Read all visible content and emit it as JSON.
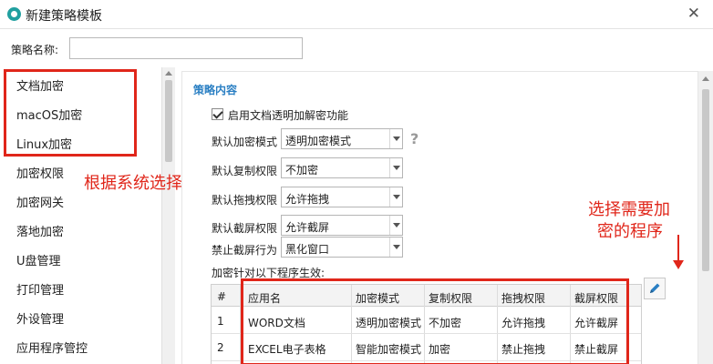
{
  "window": {
    "title": "新建策略模板",
    "close_glyph": "✕"
  },
  "name_row": {
    "label": "策略名称:",
    "value": ""
  },
  "sidebar": {
    "items": [
      {
        "label": "文档加密"
      },
      {
        "label": "macOS加密"
      },
      {
        "label": "Linux加密"
      },
      {
        "label": "加密权限"
      },
      {
        "label": "加密网关"
      },
      {
        "label": "落地加密"
      },
      {
        "label": "U盘管理"
      },
      {
        "label": "打印管理"
      },
      {
        "label": "外设管理"
      },
      {
        "label": "应用程序管控"
      }
    ],
    "more_glyph": "⋮"
  },
  "annotations": {
    "system_select": "根据系统选择",
    "program_select_line1": "选择需要加",
    "program_select_line2": "密的程序",
    "color": "#e0261a"
  },
  "policy": {
    "section_title": "策略内容",
    "enable_checkbox_label": "启用文档透明加解密功能",
    "enable_checked": true,
    "help_glyph": "?",
    "rows": [
      {
        "label": "默认加密模式",
        "value": "透明加密模式"
      },
      {
        "label": "默认复制权限",
        "value": "不加密"
      },
      {
        "label": "默认拖拽权限",
        "value": "允许拖拽"
      },
      {
        "label": "默认截屏权限",
        "value": "允许截屏"
      },
      {
        "label": "禁止截屏行为",
        "value": "黑化窗口"
      }
    ],
    "apply_label": "加密针对以下程序生效:"
  },
  "table": {
    "headers": [
      "#",
      "应用名",
      "加密模式",
      "复制权限",
      "拖拽权限",
      "截屏权限"
    ],
    "rows": [
      [
        "1",
        "WORD文档",
        "透明加密模式",
        "不加密",
        "允许拖拽",
        "允许截屏"
      ],
      [
        "2",
        "EXCEL电子表格",
        "智能加密模式",
        "加密",
        "禁止拖拽",
        "禁止截屏"
      ]
    ]
  },
  "icons": {
    "app": "app-logo-icon",
    "close": "close-icon",
    "help": "question-icon",
    "edit": "pencil-icon",
    "dropdown": "chevron-down-icon"
  },
  "colors": {
    "accent": "#2a7fc3",
    "annotation": "#e0261a"
  }
}
